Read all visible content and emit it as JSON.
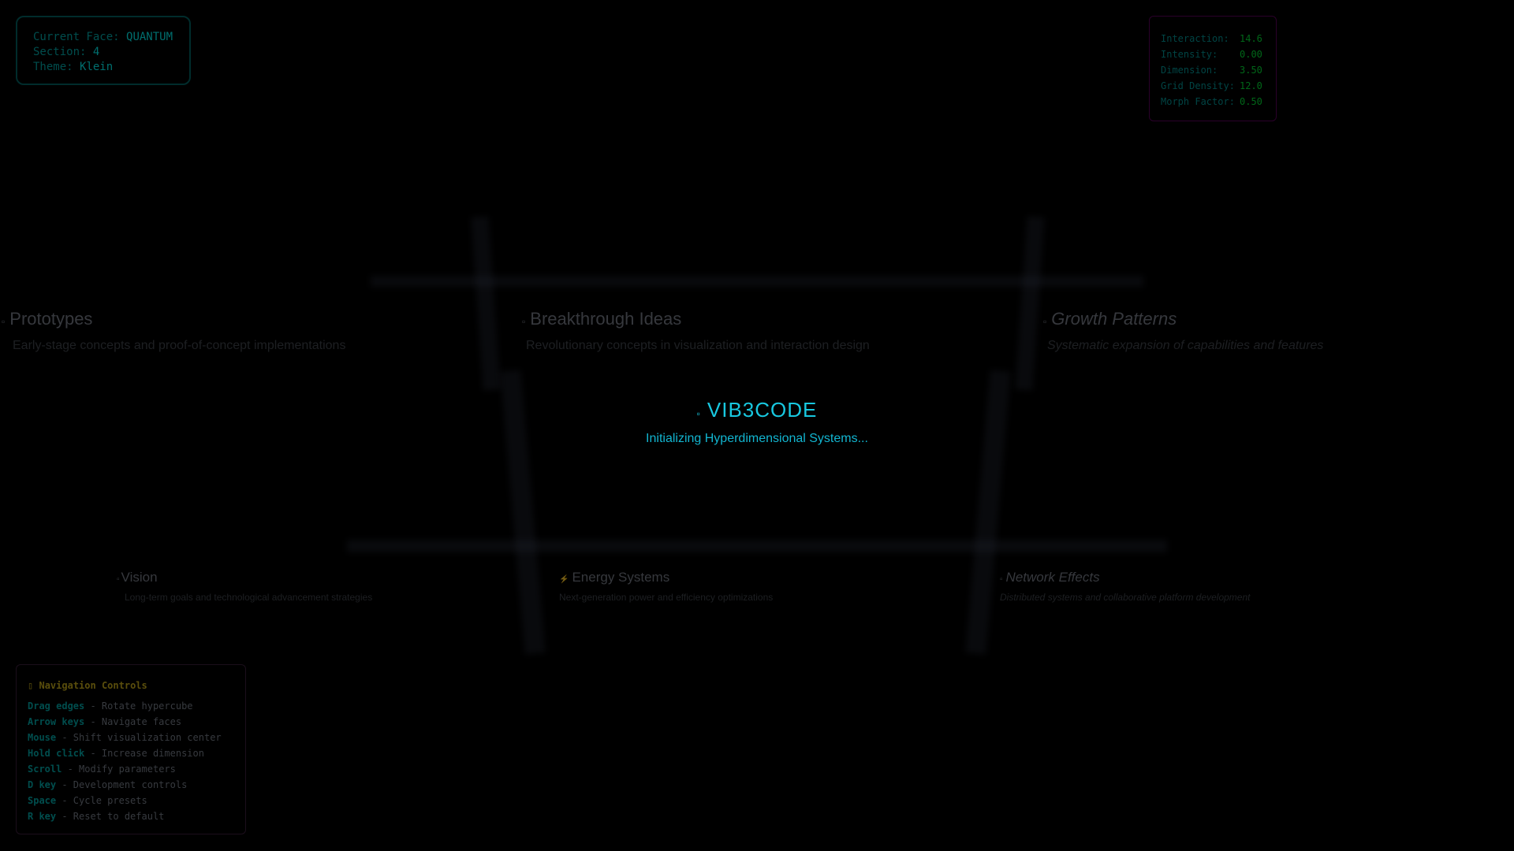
{
  "face_info": {
    "current_face_label": "Current Face:",
    "current_face_value": "QUANTUM",
    "section_label": "Section:",
    "section_value": "4",
    "theme_label": "Theme:",
    "theme_value": "Klein"
  },
  "parameters": [
    {
      "label": "Interaction:",
      "value": "14.6"
    },
    {
      "label": "Intensity:",
      "value": "0.00"
    },
    {
      "label": "Dimension:",
      "value": "3.50"
    },
    {
      "label": "Grid Density:",
      "value": "12.0"
    },
    {
      "label": "Morph Factor:",
      "value": "0.50"
    }
  ],
  "sections_top": [
    {
      "icon": "▫",
      "title": "Prototypes",
      "desc": "Early-stage concepts and proof-of-concept implementations"
    },
    {
      "icon": "▫",
      "title": "Breakthrough Ideas",
      "desc": "Revolutionary concepts in visualization and interaction design"
    },
    {
      "icon": "▫",
      "title": "Growth Patterns",
      "desc": "Systematic expansion of capabilities and features"
    }
  ],
  "sections_bottom": [
    {
      "icon": "▫",
      "title": "Vision",
      "desc": "Long-term goals and technological advancement strategies"
    },
    {
      "icon": "⚡",
      "title": "Energy Systems",
      "desc": "Next-generation power and efficiency optimizations"
    },
    {
      "icon": "▫",
      "title": "Network Effects",
      "desc": "Distributed systems and collaborative platform development"
    }
  ],
  "loader": {
    "icon": "▫",
    "title": "VIB3CODE",
    "subtitle": "Initializing Hyperdimensional Systems..."
  },
  "navigation": {
    "heading_icon": "▯",
    "heading": "Navigation Controls",
    "items": [
      {
        "key": "Drag edges",
        "action": "- Rotate hypercube"
      },
      {
        "key": "Arrow keys",
        "action": "- Navigate faces"
      },
      {
        "key": "Mouse",
        "action": "- Shift visualization center"
      },
      {
        "key": "Hold click",
        "action": "- Increase dimension"
      },
      {
        "key": "Scroll",
        "action": "- Modify parameters"
      },
      {
        "key": "D key",
        "action": "- Development controls"
      },
      {
        "key": "Space",
        "action": "- Cycle presets"
      },
      {
        "key": "R key",
        "action": "- Reset to default"
      }
    ]
  },
  "colors": {
    "background": "#000000",
    "accent_cyan": "#18c8e0"
  }
}
